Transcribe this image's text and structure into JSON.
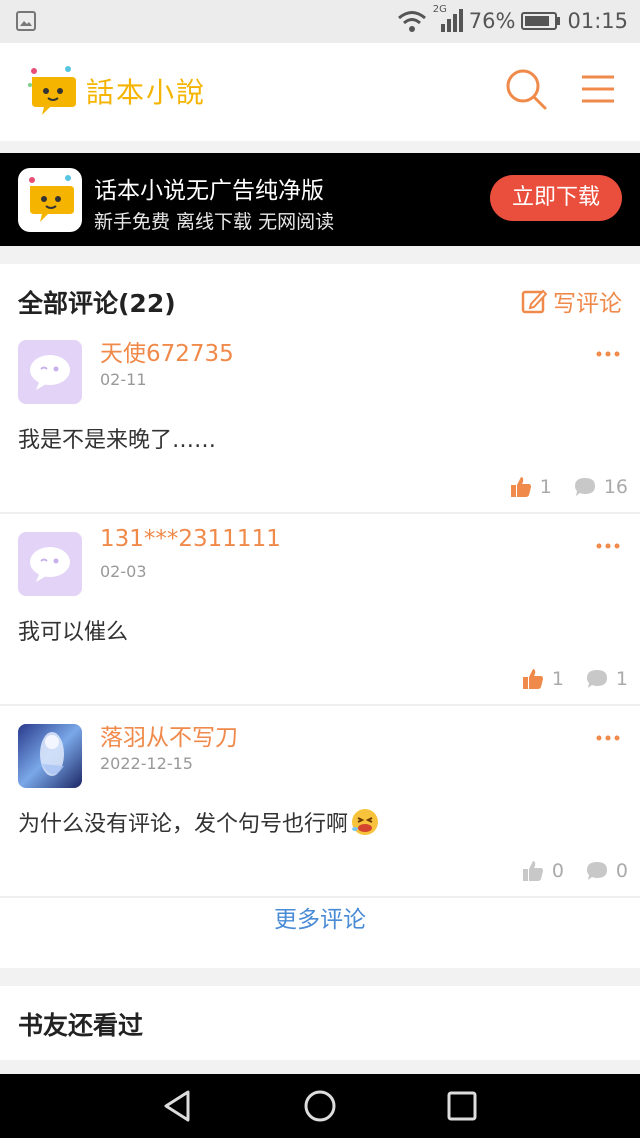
{
  "status_bar": {
    "network": "2G",
    "battery": "76%",
    "time": "01:15"
  },
  "header": {
    "logo_text": "話本小說"
  },
  "banner": {
    "title": "话本小说无广告纯净版",
    "subtitle": "新手免费 离线下载 无网阅读",
    "download_label": "立即下载"
  },
  "comments": {
    "title": "全部评论(22)",
    "write_label": "写评论",
    "items": [
      {
        "user": "天使672735",
        "date": "02-11",
        "text": "我是不是来晚了……",
        "likes": "1",
        "replies": "16",
        "active_like": true
      },
      {
        "user": "131***2311111",
        "date": "02-03",
        "text": "我可以催么",
        "likes": "1",
        "replies": "1",
        "active_like": true
      },
      {
        "user": "落羽从不写刀",
        "date": "2022-12-15",
        "text": "为什么没有评论，发个句号也行啊",
        "likes": "0",
        "replies": "0",
        "active_like": false
      }
    ],
    "more_label": "更多评论"
  },
  "also_viewed": {
    "title": "书友还看过"
  },
  "colors": {
    "accent": "#f08a4b",
    "download": "#ea4f3d",
    "link": "#4a8bd6",
    "logo": "#f4b400"
  }
}
